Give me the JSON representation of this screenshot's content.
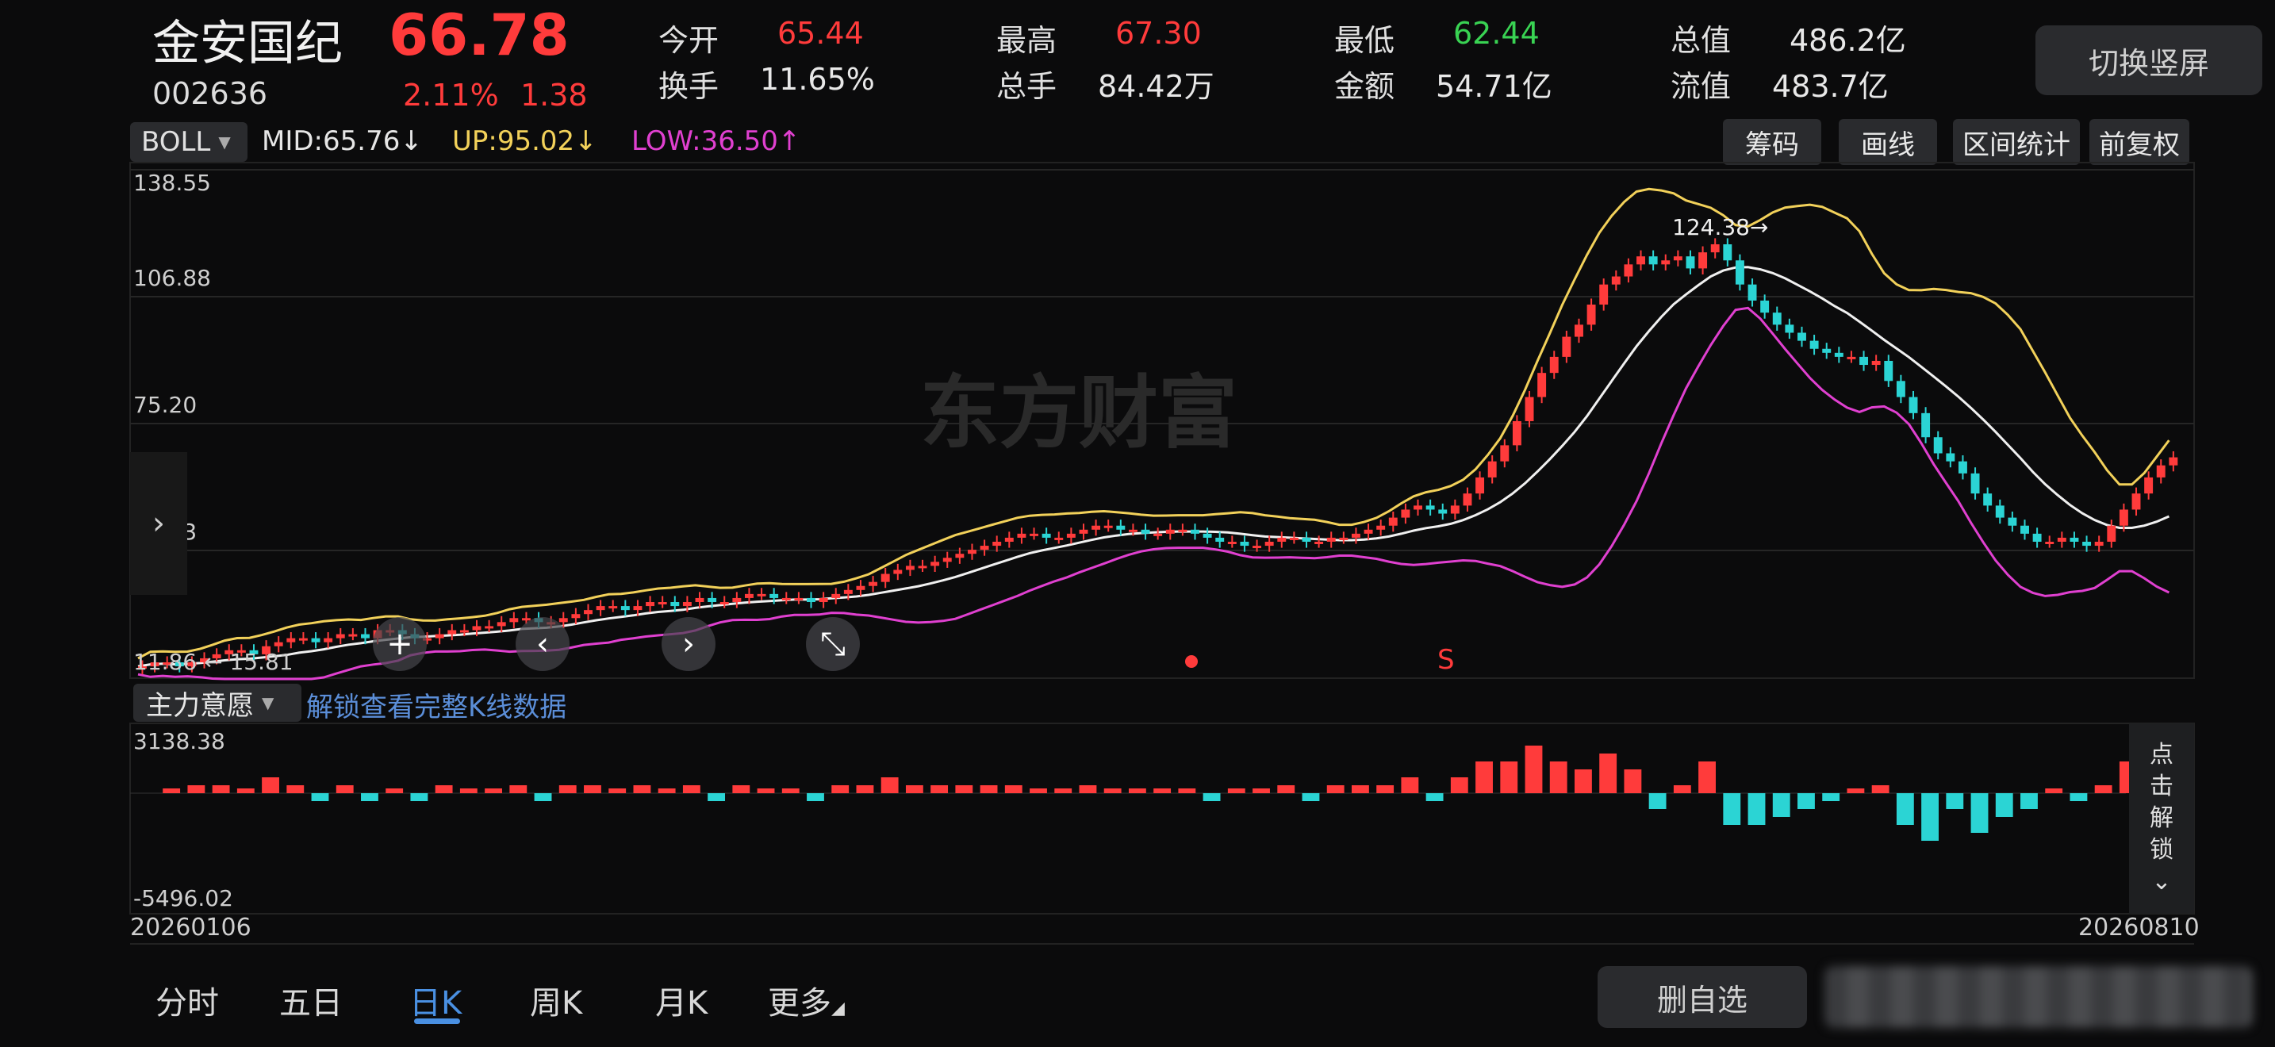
{
  "header": {
    "name": "金安国纪",
    "price": "66.78",
    "code": "002636",
    "pct": "2.11%",
    "change": "1.38",
    "stats": [
      {
        "label": "今开",
        "value": "65.44",
        "color": "red"
      },
      {
        "label": "最高",
        "value": "67.30",
        "color": "red"
      },
      {
        "label": "最低",
        "value": "62.44",
        "color": "green"
      },
      {
        "label": "总值",
        "value": "486.2亿",
        "color": "white"
      },
      {
        "label": "换手",
        "value": "11.65%",
        "color": "white"
      },
      {
        "label": "总手",
        "value": "84.42万",
        "color": "white"
      },
      {
        "label": "金额",
        "value": "54.71亿",
        "color": "white"
      },
      {
        "label": "流值",
        "value": "483.7亿",
        "color": "white"
      }
    ],
    "switch_label": "切换竖屏"
  },
  "indicator": {
    "name": "BOLL",
    "mid": "MID:65.76",
    "up": "UP:95.02",
    "low": "LOW:36.50",
    "mid_arrow": "↓",
    "up_arrow": "↓",
    "low_arrow": "↑"
  },
  "tools": [
    "筹码",
    "画线",
    "区间统计",
    "前复权"
  ],
  "chart_data": {
    "type": "candlestick",
    "y_ticks": [
      "138.55",
      "106.88",
      "75.20",
      "43.53"
    ],
    "low_label": "11.86",
    "low_label_2": "15.81",
    "high_label": "124.38",
    "watermark": "东方财富",
    "x_start": "20260106",
    "x_end": "20260810",
    "ylim": [
      11.86,
      138.55
    ],
    "candles": [
      15,
      16,
      16,
      15,
      16,
      17,
      18,
      19,
      19,
      18,
      20,
      21,
      22,
      22,
      21,
      22,
      23,
      23,
      22,
      24,
      24,
      23,
      22,
      22,
      23,
      24,
      24,
      25,
      25,
      26,
      27,
      27,
      26,
      26,
      27,
      28,
      29,
      30,
      30,
      29,
      30,
      31,
      31,
      30,
      31,
      32,
      31,
      31,
      32,
      33,
      33,
      32,
      32,
      32,
      31,
      32,
      33,
      34,
      35,
      36,
      38,
      39,
      40,
      40,
      41,
      42,
      43,
      44,
      45,
      46,
      47,
      48,
      48,
      47,
      47,
      48,
      49,
      50,
      50,
      49,
      49,
      48,
      48,
      49,
      49,
      48,
      47,
      46,
      46,
      45,
      45,
      46,
      47,
      47,
      46,
      46,
      47,
      47,
      48,
      49,
      50,
      52,
      54,
      55,
      54,
      53,
      55,
      58,
      62,
      66,
      70,
      76,
      82,
      88,
      92,
      97,
      100,
      105,
      110,
      112,
      115,
      117,
      115,
      116,
      117,
      114,
      118,
      120,
      116,
      110,
      106,
      103,
      100,
      98,
      96,
      94,
      93,
      92,
      92,
      90,
      91,
      86,
      82,
      78,
      72,
      68,
      66,
      63,
      58,
      55,
      52,
      50,
      48,
      46,
      46,
      47,
      46,
      45,
      46,
      50,
      54,
      58,
      62,
      65,
      67
    ]
  },
  "oscillator": {
    "label": "主力意愿",
    "unlock_text": "解锁查看完整K线数据",
    "max": "3138.38",
    "min": "-5496.02",
    "side_text": [
      "点",
      "击",
      "解",
      "锁"
    ],
    "side_chev": "⌄"
  },
  "tabs": [
    "分时",
    "五日",
    "日K",
    "周K",
    "月K",
    "更多"
  ],
  "active_tab": "日K",
  "bottom": {
    "remove_label": "删自选"
  }
}
